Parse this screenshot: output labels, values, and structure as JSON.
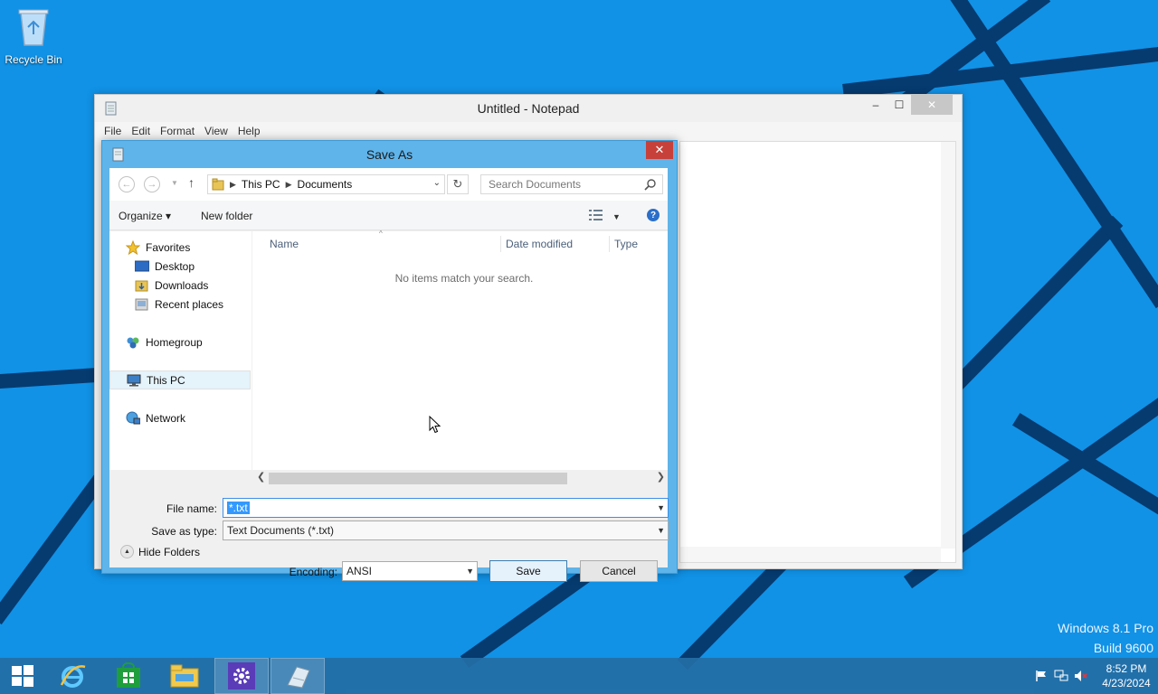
{
  "desktop": {
    "recycle_bin_label": "Recycle Bin",
    "watermark_line1": "Windows 8.1 Pro",
    "watermark_line2": "Build 9600"
  },
  "notepad": {
    "title": "Untitled - Notepad",
    "menu": [
      "File",
      "Edit",
      "Format",
      "View",
      "Help"
    ],
    "controls": {
      "minimize": "–",
      "maximize": "☐",
      "close": "✕"
    }
  },
  "save_dialog": {
    "title": "Save As",
    "close": "✕",
    "address": {
      "crumbs": [
        "This PC",
        "Documents"
      ]
    },
    "search_placeholder": "Search Documents",
    "commands": {
      "organize": "Organize ▾",
      "new_folder": "New folder",
      "help": "?"
    },
    "nav": {
      "favorites": "Favorites",
      "desktop": "Desktop",
      "downloads": "Downloads",
      "recent": "Recent places",
      "homegroup": "Homegroup",
      "this_pc": "This PC",
      "network": "Network",
      "selected": "This PC"
    },
    "columns": [
      "Name",
      "Date modified",
      "Type"
    ],
    "empty_message": "No items match your search.",
    "file_name_label": "File name:",
    "file_name_value": "*.txt",
    "save_type_label": "Save as type:",
    "save_type_value": "Text Documents (*.txt)",
    "encoding_label": "Encoding:",
    "encoding_value": "ANSI",
    "hide_folders": "Hide Folders",
    "save_button": "Save",
    "cancel_button": "Cancel"
  },
  "taskbar": {
    "time": "8:52 PM",
    "date": "4/23/2024",
    "apps": [
      "start-icon",
      "internet-explorer-icon",
      "store-icon",
      "file-explorer-icon",
      "settings-icon",
      "notepad-icon"
    ],
    "active_app": "notepad-icon"
  },
  "colors": {
    "desktop_bg": "#1192e6",
    "dialog_frame": "#5fb4ea",
    "close_red": "#c7403a",
    "taskbar": "#246ea5",
    "selection": "#3399ff"
  }
}
